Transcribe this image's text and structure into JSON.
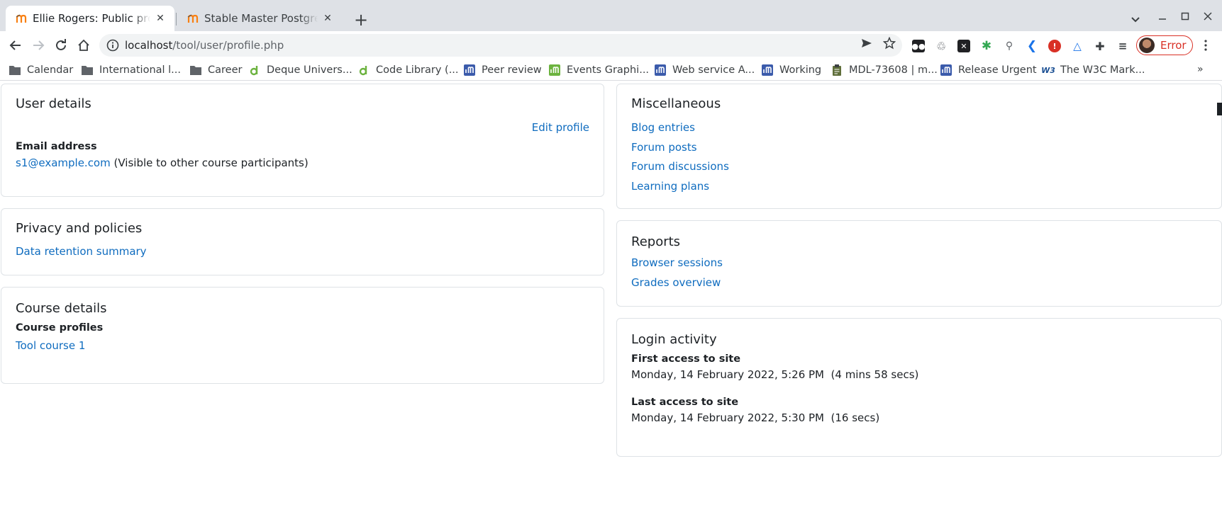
{
  "browser": {
    "tabs": [
      {
        "title": "Ellie Rogers: Public profile",
        "active": true
      },
      {
        "title": "Stable Master PostgreSQL",
        "active": false
      }
    ],
    "address": {
      "host": "localhost",
      "path": "/tool/user/profile.php"
    },
    "profile_status": "Error",
    "bookmarks": [
      {
        "label": "Calendar",
        "icon": "folder-icon"
      },
      {
        "label": "International l...",
        "icon": "folder-icon"
      },
      {
        "label": "Career",
        "icon": "folder-icon"
      },
      {
        "label": "Deque Univers...",
        "icon": "deque-icon"
      },
      {
        "label": "Code Library (...",
        "icon": "deque-icon"
      },
      {
        "label": "Peer review",
        "icon": "moodle-tracker-icon"
      },
      {
        "label": "Events Graphi...",
        "icon": "moodle-green-icon"
      },
      {
        "label": "Web service A...",
        "icon": "moodle-tracker-icon"
      },
      {
        "label": "Working",
        "icon": "moodle-tracker-icon"
      },
      {
        "label": "MDL-73608 | m...",
        "icon": "clipboard-icon"
      },
      {
        "label": "Release Urgent",
        "icon": "moodle-tracker-icon"
      },
      {
        "label": "The W3C Mark...",
        "icon": "w3c-icon"
      }
    ],
    "colors": {
      "accent_link": "#0f6cbf",
      "error": "#d93025"
    }
  },
  "page": {
    "user_details": {
      "heading": "User details",
      "edit_profile": "Edit profile",
      "email_label": "Email address",
      "email_value": "s1@example.com",
      "email_visibility": "(Visible to other course participants)"
    },
    "privacy": {
      "heading": "Privacy and policies",
      "data_retention": "Data retention summary"
    },
    "course_details": {
      "heading": "Course details",
      "profiles_label": "Course profiles",
      "course_link": "Tool course 1"
    },
    "miscellaneous": {
      "heading": "Miscellaneous",
      "links": [
        "Blog entries",
        "Forum posts",
        "Forum discussions",
        "Learning plans"
      ]
    },
    "reports": {
      "heading": "Reports",
      "links": [
        "Browser sessions",
        "Grades overview"
      ]
    },
    "login_activity": {
      "heading": "Login activity",
      "first_label": "First access to site",
      "first_value": "Monday, 14 February 2022, 5:26 PM  (4 mins 58 secs)",
      "last_label": "Last access to site",
      "last_value": "Monday, 14 February 2022, 5:30 PM  (16 secs)"
    }
  }
}
